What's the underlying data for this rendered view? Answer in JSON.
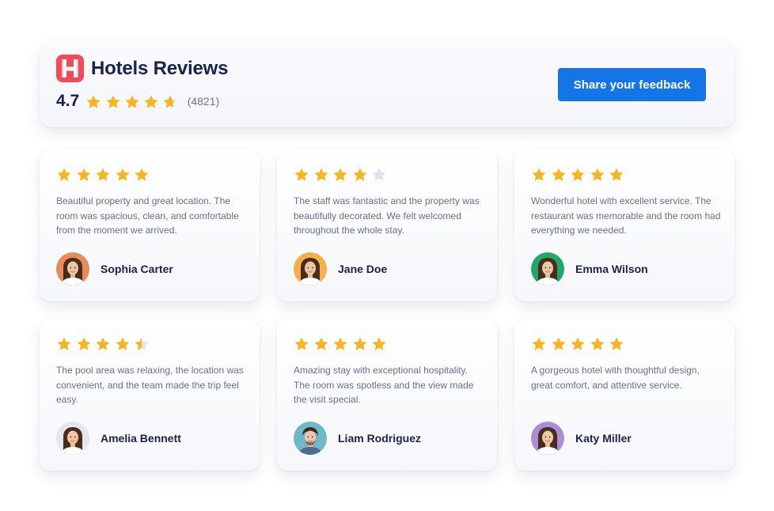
{
  "header": {
    "title": "Hotels Reviews",
    "rating": "4.7",
    "rating_stars": 4.7,
    "review_count": "(4821)",
    "share_button_label": "Share your feedback"
  },
  "colors": {
    "brand": "#f14a5a",
    "accent": "#1476e6",
    "star": "#f9b51e",
    "star_empty": "#dfe2f0",
    "heading": "#1b2150",
    "body_text": "#6a6f8f"
  },
  "reviews": [
    {
      "rating": 5,
      "text": "Beautiful property and great location. The room was spacious, clean, and comfortable from the moment we arrived.",
      "name": "Sophia Carter",
      "avatar_icon": "woman-portrait-icon",
      "avatar_bg": "#e98a5a"
    },
    {
      "rating": 4,
      "text": "The staff was fantastic and the property was beautifully decorated. We felt welcomed throughout the whole stay.",
      "name": "Jane Doe",
      "avatar_icon": "woman-portrait-icon",
      "avatar_bg": "#f6b049"
    },
    {
      "rating": 5,
      "text": "Wonderful hotel with excellent service. The restaurant was memorable and the room had everything we needed.",
      "name": "Emma Wilson",
      "avatar_icon": "woman-portrait-icon",
      "avatar_bg": "#1fa86a"
    },
    {
      "rating": 4.5,
      "text": "The pool area was relaxing, the location was convenient, and the team made the trip feel easy.",
      "name": "Amelia Bennett",
      "avatar_icon": "woman-portrait-icon",
      "avatar_bg": "#e4e6f0"
    },
    {
      "rating": 5,
      "text": "Amazing stay with exceptional hospitality. The room was spotless and the view made the visit special.",
      "name": "Liam Rodriguez",
      "avatar_icon": "man-portrait-icon",
      "avatar_bg": "#6fb8c8"
    },
    {
      "rating": 5,
      "text": "A gorgeous hotel with thoughtful design, great comfort, and attentive service.",
      "name": "Katy Miller",
      "avatar_icon": "woman-portrait-icon",
      "avatar_bg": "#a88fd8"
    }
  ]
}
